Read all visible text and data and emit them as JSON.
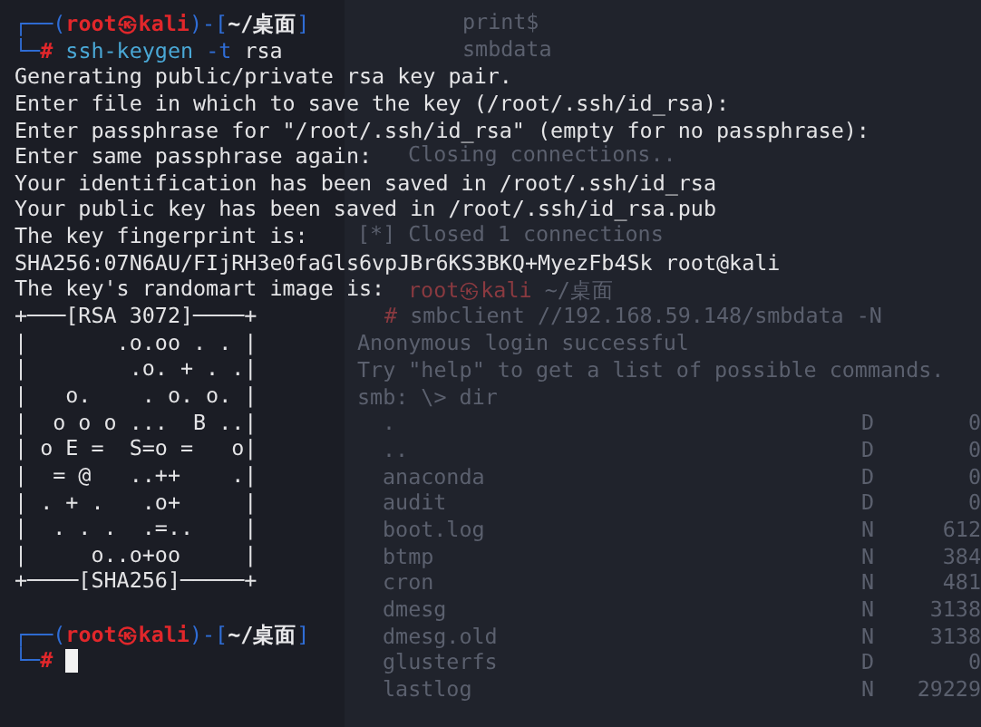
{
  "behind_window": {
    "groups": [
      {
        "lines": [
          [
            {
              "kind": "text",
              "text": "print$"
            }
          ],
          [
            {
              "kind": "text",
              "text": "smbdata"
            }
          ]
        ]
      },
      {
        "lines": [
          [
            {
              "kind": "text",
              "text": "Closing connections.."
            }
          ]
        ]
      },
      {
        "lines": [
          [
            {
              "kind": "text",
              "text": "[*] Closed 1 connections"
            }
          ]
        ]
      },
      {
        "lines": [
          [
            {
              "kind": "user",
              "text": "root㉿kali"
            },
            {
              "kind": "text",
              "text": " ~/桌面"
            }
          ],
          [
            {
              "kind": "hash",
              "text": "# "
            },
            {
              "kind": "text",
              "text": "smbclient //192.168.59.148/smbdata -N"
            }
          ],
          [
            {
              "kind": "text",
              "text": "Anonymous login successful"
            }
          ],
          [
            {
              "kind": "text",
              "text": "Try \"help\" to get a list of possible commands."
            }
          ],
          [
            {
              "kind": "text",
              "text": "smb: \\> dir"
            }
          ]
        ]
      }
    ],
    "entries": [
      {
        "name": ".",
        "attr": "D",
        "size": "0"
      },
      {
        "name": "..",
        "attr": "D",
        "size": "0"
      },
      {
        "name": "anaconda",
        "attr": "D",
        "size": "0"
      },
      {
        "name": "audit",
        "attr": "D",
        "size": "0"
      },
      {
        "name": "boot.log",
        "attr": "N",
        "size": "612"
      },
      {
        "name": "btmp",
        "attr": "N",
        "size": "384"
      },
      {
        "name": "cron",
        "attr": "N",
        "size": "481"
      },
      {
        "name": "dmesg",
        "attr": "N",
        "size": "3138"
      },
      {
        "name": "dmesg.old",
        "attr": "N",
        "size": "3138"
      },
      {
        "name": "glusterfs",
        "attr": "D",
        "size": "0"
      },
      {
        "name": "lastlog",
        "attr": "N",
        "size": "29229"
      }
    ]
  },
  "terminal": {
    "lines": [
      [
        {
          "kind": "frame",
          "text": "┌──("
        },
        {
          "kind": "user",
          "text": "root㉿kali"
        },
        {
          "kind": "frame",
          "text": ")-["
        },
        {
          "kind": "path",
          "text": "~/桌面"
        },
        {
          "kind": "frame",
          "text": "]"
        }
      ],
      [
        {
          "kind": "frame",
          "text": "└─"
        },
        {
          "kind": "hash",
          "text": "# "
        },
        {
          "kind": "command",
          "text": "ssh-keygen"
        },
        {
          "kind": "flag",
          "text": " -t"
        },
        {
          "kind": "out",
          "text": " rsa"
        }
      ],
      [
        {
          "kind": "out",
          "text": "Generating public/private rsa key pair."
        }
      ],
      [
        {
          "kind": "out",
          "text": "Enter file in which to save the key (/root/.ssh/id_rsa):"
        }
      ],
      [
        {
          "kind": "out",
          "text": "Enter passphrase for \"/root/.ssh/id_rsa\" (empty for no passphrase):"
        }
      ],
      [
        {
          "kind": "out",
          "text": "Enter same passphrase again:"
        }
      ],
      [
        {
          "kind": "out",
          "text": "Your identification has been saved in /root/.ssh/id_rsa"
        }
      ],
      [
        {
          "kind": "out",
          "text": "Your public key has been saved in /root/.ssh/id_rsa.pub"
        }
      ],
      [
        {
          "kind": "out",
          "text": "The key fingerprint is:"
        }
      ],
      [
        {
          "kind": "out",
          "text": "SHA256:07N6AU/FIjRH3e0faGls6vpJBr6KS3BKQ+MyezFb4Sk root@kali"
        }
      ],
      [
        {
          "kind": "out",
          "text": "The key's randomart image is:"
        }
      ],
      [
        {
          "kind": "out",
          "text": "+───[RSA 3072]────+"
        }
      ],
      [
        {
          "kind": "out",
          "text": "|       .o.oo . . |"
        }
      ],
      [
        {
          "kind": "out",
          "text": "|        .o. + . .|"
        }
      ],
      [
        {
          "kind": "out",
          "text": "|   o.    . o. o. |"
        }
      ],
      [
        {
          "kind": "out",
          "text": "|  o o o ...  B ..|"
        }
      ],
      [
        {
          "kind": "out",
          "text": "| o E =  S=o =   o|"
        }
      ],
      [
        {
          "kind": "out",
          "text": "|  = @   ..++    .|"
        }
      ],
      [
        {
          "kind": "out",
          "text": "| . + .   .o+     |"
        }
      ],
      [
        {
          "kind": "out",
          "text": "|  . . .  .=..    |"
        }
      ],
      [
        {
          "kind": "out",
          "text": "|     o..o+oo     |"
        }
      ],
      [
        {
          "kind": "out",
          "text": "+────[SHA256]─────+"
        }
      ],
      [
        {
          "kind": "frame",
          "text": "┌──("
        },
        {
          "kind": "user",
          "text": "root㉿kali"
        },
        {
          "kind": "frame",
          "text": ")-["
        },
        {
          "kind": "path",
          "text": "~/桌面"
        },
        {
          "kind": "frame",
          "text": "]"
        }
      ],
      [
        {
          "kind": "frame",
          "text": "└─"
        },
        {
          "kind": "hash",
          "text": "# "
        },
        {
          "kind": "cursor"
        }
      ]
    ]
  }
}
